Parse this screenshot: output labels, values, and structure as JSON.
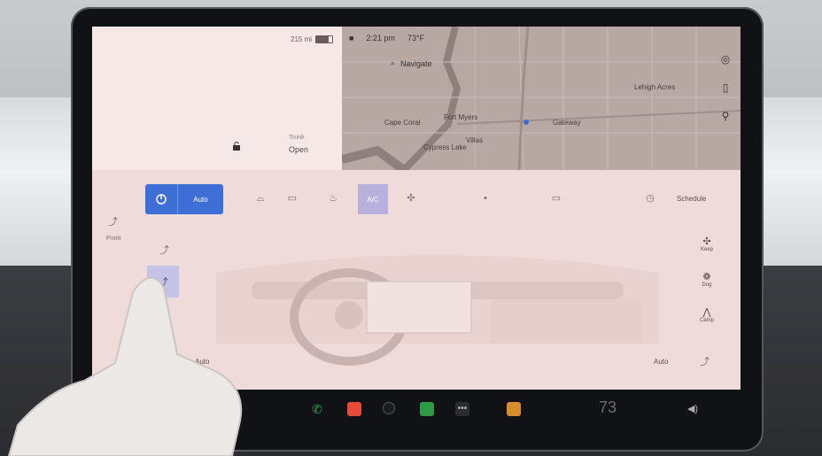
{
  "status": {
    "range": "215 mi",
    "time": "2:21 pm",
    "temperature": "73°F",
    "battery_fraction": 0.8
  },
  "trunk": {
    "label": "Trunk",
    "value": "Open"
  },
  "map": {
    "search_placeholder": "Navigate",
    "labels": [
      "Cape Coral",
      "Fort Myers",
      "Lehigh Acres",
      "Gateway",
      "Villas",
      "Cypress Lake"
    ]
  },
  "climate": {
    "auto_label": "Auto",
    "ac_label": "A/C",
    "schedule_label": "Schedule",
    "front_label": "Front",
    "left_auto": "Auto",
    "right_auto": "Auto",
    "modes": [
      "Keep",
      "Dog",
      "Camp"
    ]
  },
  "taskbar": {
    "left_temp": "69",
    "right_temp": "73"
  },
  "colors": {
    "accent": "#3d6fd6",
    "ac_active": "#b9b0dc",
    "screen_tint": "#f3e4e2"
  },
  "icons": [
    "power-icon",
    "defrost-front-icon",
    "defrost-rear-icon",
    "seat-heater-icon",
    "fan-icon",
    "clock-icon",
    "phone-icon",
    "volume-icon",
    "lock-icon",
    "search-icon"
  ]
}
